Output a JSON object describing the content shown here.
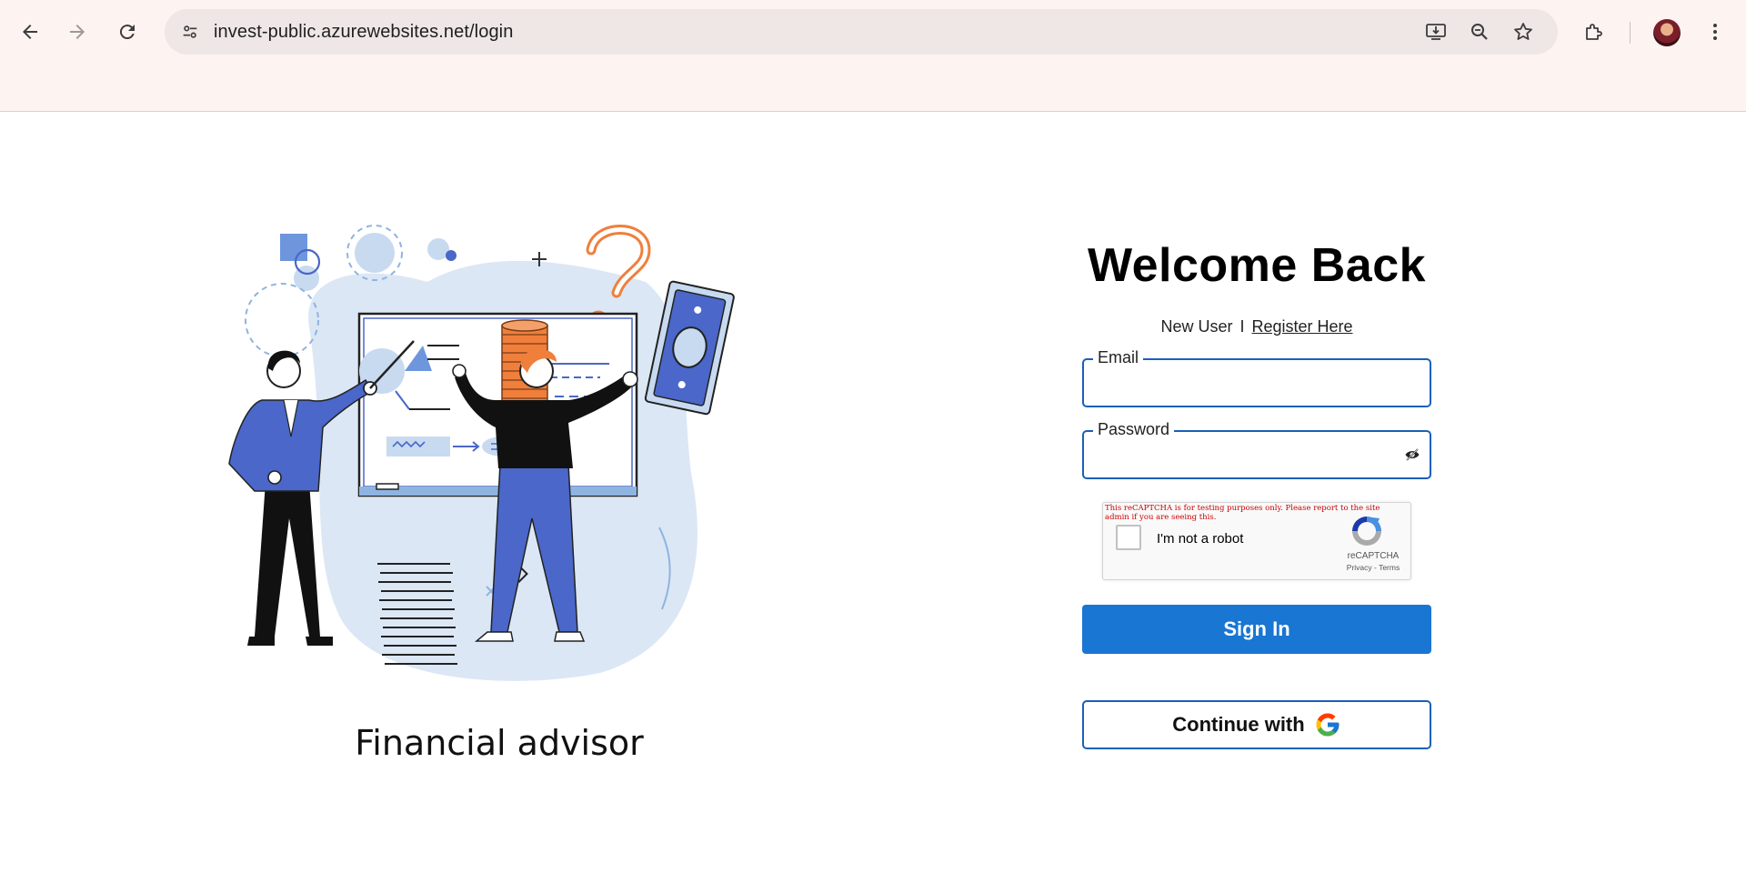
{
  "browser": {
    "url": "invest-public.azurewebsites.net/login",
    "icons": [
      "back-icon",
      "forward-icon",
      "reload-icon",
      "site-info-icon",
      "install-app-icon",
      "zoom-icon",
      "bookmark-star-icon",
      "extensions-icon",
      "profile-avatar",
      "more-menu-icon"
    ]
  },
  "illustration": {
    "caption": "Financial advisor"
  },
  "login": {
    "title": "Welcome Back",
    "new_user_text": "New User",
    "separator": "I",
    "register_link": "Register Here",
    "email_label": "Email",
    "email_value": "",
    "password_label": "Password",
    "password_value": "",
    "signin_label": "Sign In",
    "google_label": "Continue with"
  },
  "recaptcha": {
    "warning": "This reCAPTCHA is for testing purposes only. Please report to the site admin if you are seeing this.",
    "checkbox_label": "I'm not a robot",
    "brand": "reCAPTCHA",
    "links": "Privacy - Terms",
    "checked": false
  },
  "colors": {
    "primary": "#1976d2",
    "field_border": "#1a60b8",
    "chrome_bg": "#fdf4f2",
    "illustration_blue": "#4a67c9",
    "illustration_orange": "#f07f3c",
    "illustration_light": "#dce7f5"
  }
}
